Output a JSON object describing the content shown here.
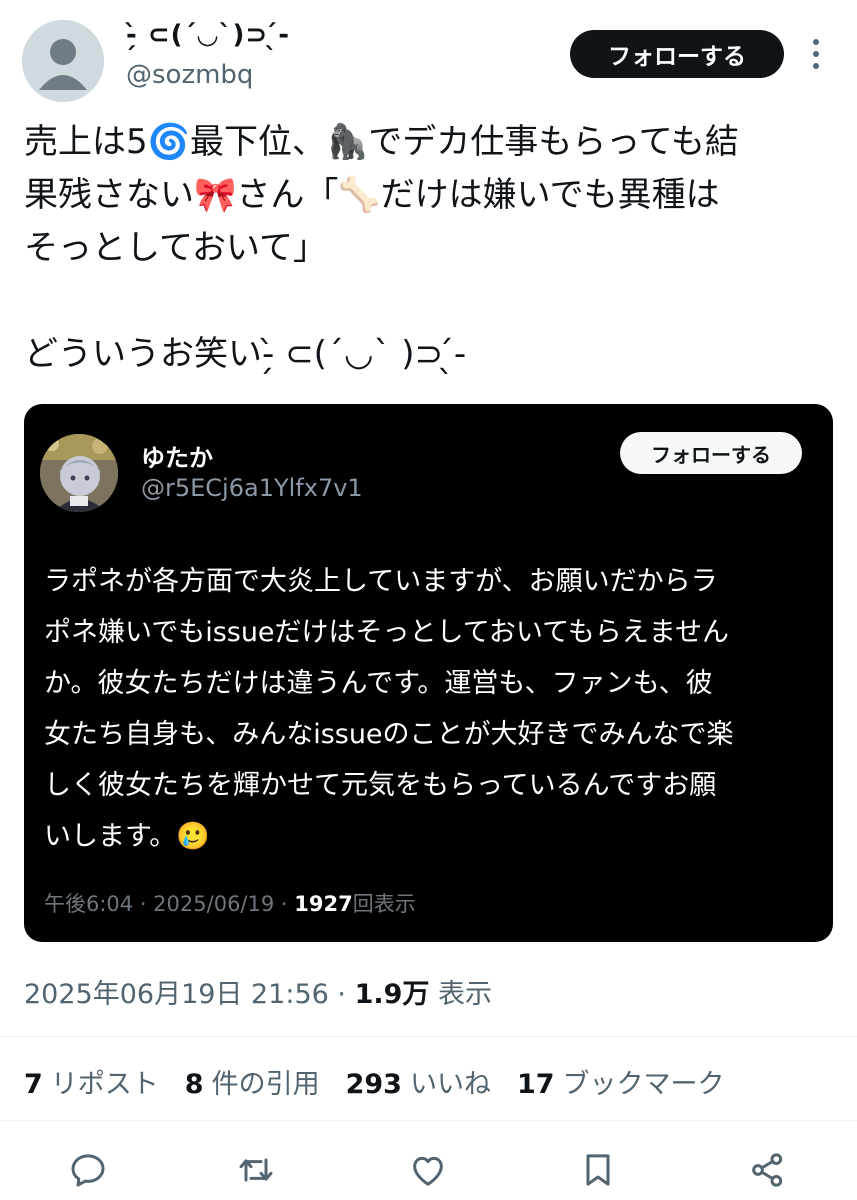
{
  "author": {
    "display_name": "-̗̀ ⊂(´◡`)⊃ ̖́-",
    "handle": "@sozmbq",
    "follow_label": "フォローする"
  },
  "tweet": {
    "lines": [
      "売上は5🌀最下位、🦍でデカ仕事もらっても結",
      "果残さない🎀さん「🦴だけは嫌いでも異種は",
      "そっとしておいて」",
      "",
      "どういうお笑い-̗̀ ⊂(´◡` )⊃ ̖́-"
    ]
  },
  "quote": {
    "display_name": "ゆたか",
    "handle": "@r5ECj6a1Ylfx7v1",
    "follow_label": "フォローする",
    "lines": [
      "ラポネが各方面で大炎上していますが、お願いだからラ",
      "ポネ嫌いでもissueだけはそっとしておいてもらえません",
      "か。彼女たちだけは違うんです。運営も、ファンも、彼",
      "女たち自身も、みんなissueのことが大好きでみんなで楽",
      "しく彼女たちを輝かせて元気をもらっているんですお願",
      "いします。🥲"
    ],
    "time": "午後6:04 · 2025/06/19 · ",
    "views_count": "1927",
    "views_label": "回表示"
  },
  "meta": {
    "timestamp": "2025年06月19日 21:56 · ",
    "views_count": "1.9万",
    "views_label": " 表示"
  },
  "stats": {
    "reposts_count": "7",
    "reposts_label": "リポスト",
    "quotes_count": "8",
    "quotes_label": "件の引用",
    "likes_count": "293",
    "likes_label": "いいね",
    "bookmarks_count": "17",
    "bookmarks_label": "ブックマーク"
  },
  "colors": {
    "text": "#0f1419",
    "secondary": "#536471",
    "quote_bg": "#000000",
    "icon": "#536471"
  }
}
